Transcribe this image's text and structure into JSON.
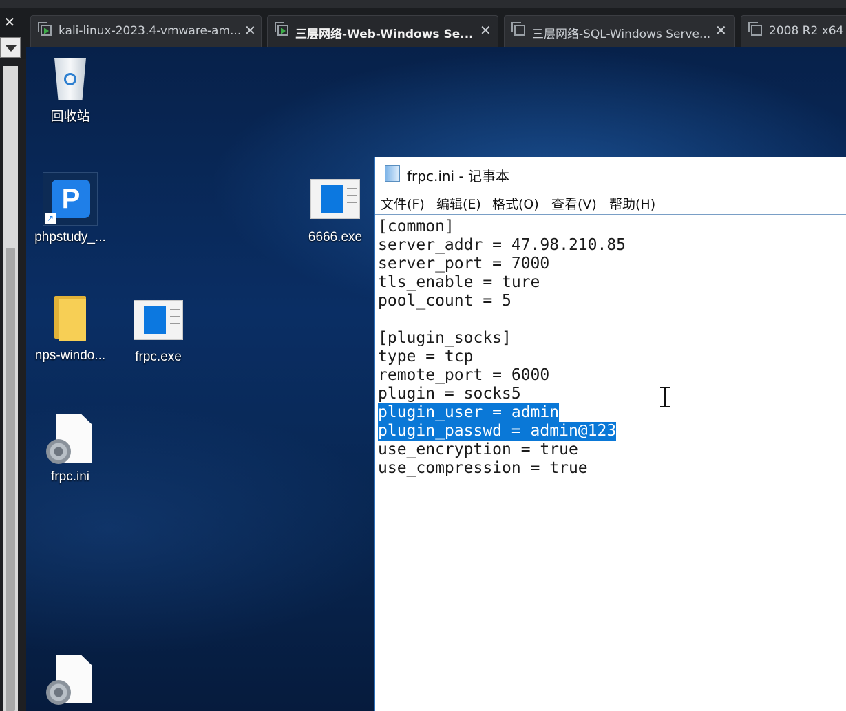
{
  "host": {
    "close_glyph": "✕",
    "tabs": [
      {
        "label": "kali-linux-2023.4-vmware-am...",
        "active": false
      },
      {
        "label": "三层网络-Web-Windows Se...",
        "active": true
      },
      {
        "label": "三层网络-SQL-Windows Serve...",
        "active": false
      },
      {
        "label": "2008 R2 x64",
        "active": false
      }
    ],
    "tab_close_glyph": "✕"
  },
  "desktop": {
    "icons": {
      "recycle_bin": "回收站",
      "phpstudy": "phpstudy_...",
      "exe_6666": "6666.exe",
      "nps_folder": "nps-windo...",
      "frpc_exe": "frpc.exe",
      "frpc_ini": "frpc.ini"
    },
    "phpstudy_letter": "P"
  },
  "notepad": {
    "title": "frpc.ini - 记事本",
    "menu": [
      "文件(F)",
      "编辑(E)",
      "格式(O)",
      "查看(V)",
      "帮助(H)"
    ],
    "lines": [
      "[common]",
      "server_addr = 47.98.210.85",
      "server_port = 7000",
      "tls_enable = ture",
      "pool_count = 5",
      "",
      "[plugin_socks]",
      "type = tcp",
      "remote_port = 6000",
      "plugin = socks5",
      "plugin_user = admin",
      "plugin_passwd = admin@123",
      "use_encryption = true",
      "use_compression = true"
    ],
    "selected_lines": [
      10,
      11
    ],
    "selection_color": "#0a78d7"
  }
}
